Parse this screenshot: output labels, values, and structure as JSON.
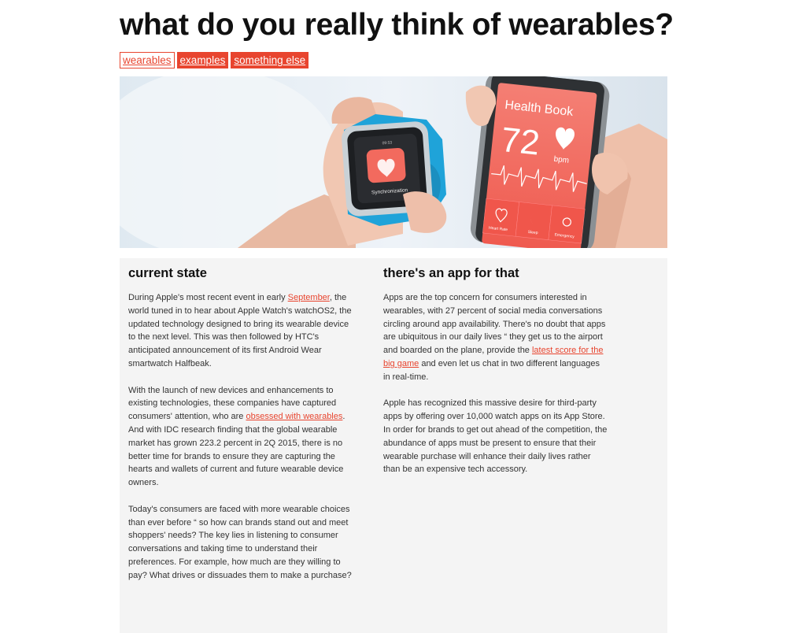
{
  "page": {
    "title": "what do you really think of wearables?"
  },
  "tags": [
    "wearables",
    "examples",
    "something else"
  ],
  "hero": {
    "watch_screen_label": "Synchronization",
    "watch_time": "09:53",
    "phone_app_title": "Health Book",
    "phone_bpm_value": "72",
    "phone_bpm_unit": "bpm",
    "phone_tiles": [
      "Heart Rate",
      "Sleep",
      "Emergency"
    ]
  },
  "col1": {
    "heading": "current state",
    "p1_a": "During Apple's most recent event in early ",
    "p1_link": "September",
    "p1_b": ", the world tuned in to hear about Apple Watch's watchOS2, the updated technology designed to bring its wearable device to the next level. This was then followed by HTC's anticipated announcement of its first Android Wear smartwatch Halfbeak.",
    "p2_a": "With the launch of new devices and enhancements to existing technologies, these companies have captured consumers' attention, who are ",
    "p2_link": "obsessed with wearables",
    "p2_b": ". And with IDC research finding that the global wearable market has grown 223.2 percent in 2Q 2015, there is no better time for brands to ensure they are capturing the hearts and wallets of current and future wearable device owners.",
    "p3": "Today's consumers are faced with more wearable choices than ever before “ so how can brands stand out and meet shoppers' needs? The key lies in listening to consumer conversations and taking time to understand their preferences. For example, how much are they willing to pay? What drives or dissuades them to make a purchase?"
  },
  "col2": {
    "heading": "there's an app for that",
    "p1_a": "Apps are the top concern for consumers interested in wearables, with 27 percent of social media conversations circling around app availability. There's no doubt that apps are ubiquitous in our daily lives “ they get us to the airport and boarded on the plane, provide the ",
    "p1_link": "latest score for the big game",
    "p1_b": " and even let us chat in two different languages in real-time.",
    "p2": "Apple has recognized this massive desire for third-party apps by offering over 10,000 watch apps on its App Store. In order for brands to get out ahead of the competition, the abundance of apps must be present to ensure that their wearable purchase will enhance their daily lives rather than be an expensive tech accessory."
  },
  "colors": {
    "accent": "#e8452f",
    "panel_bg": "#f4f4f4",
    "watch_band": "#1fa3d9",
    "phone_screen": "#f26a5e"
  }
}
